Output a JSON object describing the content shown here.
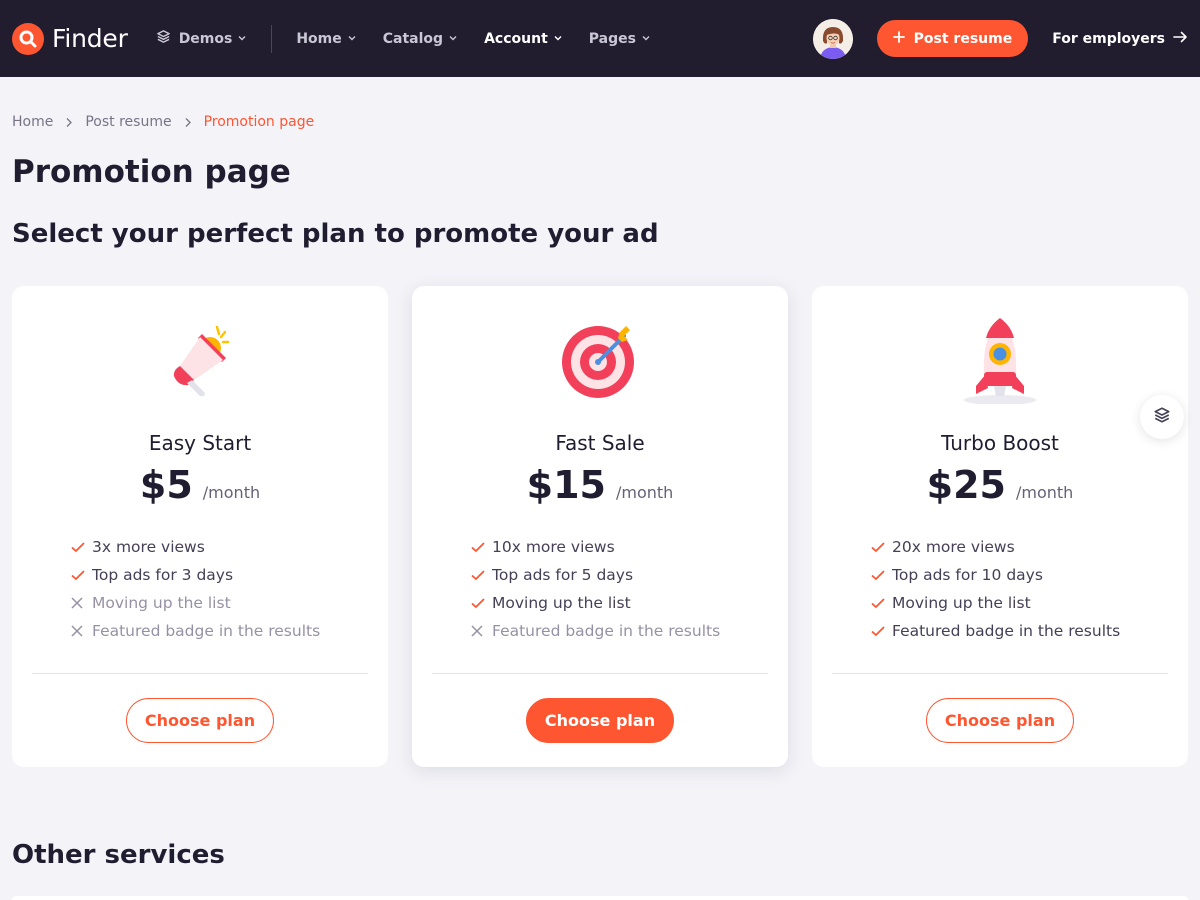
{
  "brand": {
    "name": "Finder"
  },
  "nav": {
    "demos": "Demos",
    "items": [
      {
        "label": "Home"
      },
      {
        "label": "Catalog"
      },
      {
        "label": "Account",
        "active": true
      },
      {
        "label": "Pages"
      }
    ],
    "post_resume": "Post resume",
    "for_employers": "For employers"
  },
  "breadcrumb": [
    "Home",
    "Post resume",
    "Promotion page"
  ],
  "page_title": "Promotion page",
  "subtitle": "Select your perfect plan to promote your ad",
  "plans": [
    {
      "name": "Easy Start",
      "price": "$5",
      "period": "/month",
      "icon": "megaphone-icon",
      "features": [
        {
          "text": "3x more views",
          "included": true
        },
        {
          "text": "Top ads for 3 days",
          "included": true
        },
        {
          "text": "Moving up the list",
          "included": false
        },
        {
          "text": "Featured badge in the results",
          "included": false
        }
      ],
      "button": "Choose plan"
    },
    {
      "name": "Fast Sale",
      "price": "$15",
      "period": "/month",
      "icon": "target-icon",
      "features": [
        {
          "text": "10x more views",
          "included": true
        },
        {
          "text": "Top ads for 5 days",
          "included": true
        },
        {
          "text": "Moving up the list",
          "included": true
        },
        {
          "text": "Featured badge in the results",
          "included": false
        }
      ],
      "button": "Choose plan"
    },
    {
      "name": "Turbo Boost",
      "price": "$25",
      "period": "/month",
      "icon": "rocket-icon",
      "features": [
        {
          "text": "20x more views",
          "included": true
        },
        {
          "text": "Top ads for 10 days",
          "included": true
        },
        {
          "text": "Moving up the list",
          "included": true
        },
        {
          "text": "Featured badge in the results",
          "included": true
        }
      ],
      "button": "Choose plan"
    }
  ],
  "other_services_title": "Other services",
  "colors": {
    "primary": "#fd5631",
    "navbar": "#211d2f",
    "background": "#f3f3f8",
    "heading": "#1f1d2f"
  }
}
